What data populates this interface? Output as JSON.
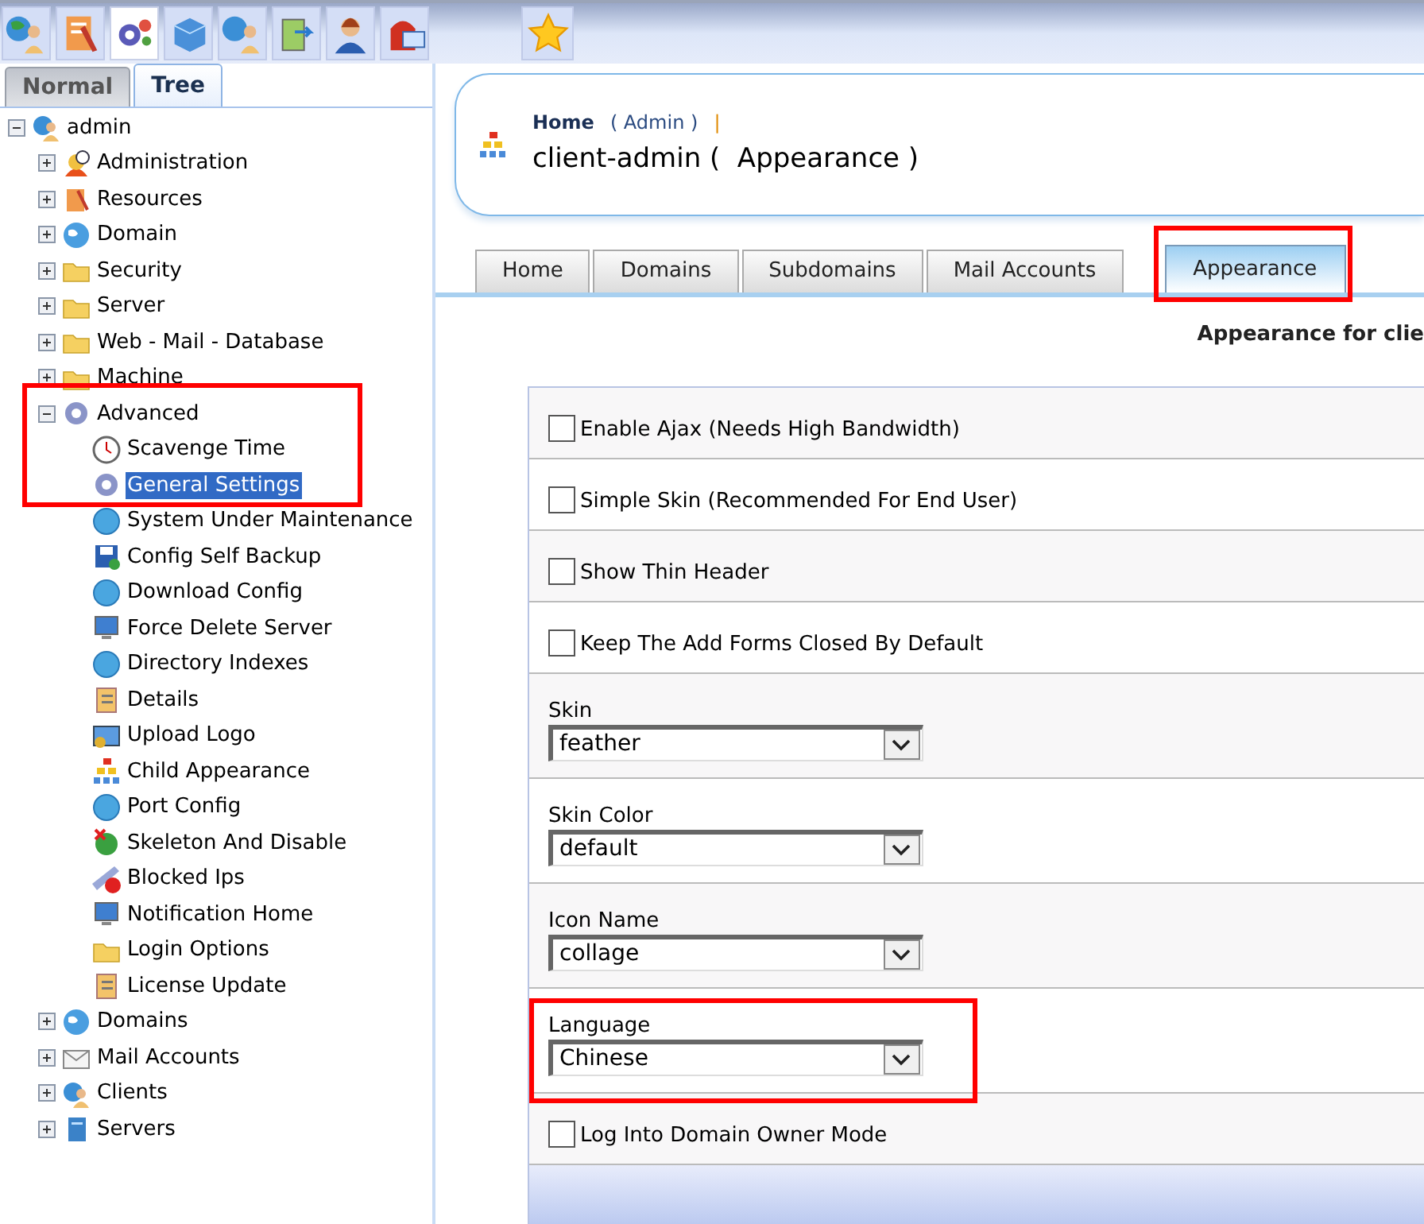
{
  "toolbar": {
    "buttons": [
      {
        "selected": false
      },
      {
        "selected": false
      },
      {
        "selected": true
      },
      {
        "selected": false
      },
      {
        "selected": false
      },
      {
        "selected": false
      },
      {
        "selected": false
      },
      {
        "selected": false
      }
    ]
  },
  "sidebar": {
    "tabs": [
      {
        "label": "Normal",
        "selected": false
      },
      {
        "label": "Tree",
        "selected": true
      }
    ],
    "tree": [
      {
        "label": "admin",
        "expanded": true,
        "selected": false,
        "children": [
          {
            "label": "Administration",
            "expanded": false,
            "selected": false
          },
          {
            "label": "Resources",
            "expanded": false,
            "selected": false
          },
          {
            "label": "Domain",
            "expanded": false,
            "selected": false
          },
          {
            "label": "Security",
            "expanded": false,
            "selected": false
          },
          {
            "label": "Server",
            "expanded": false,
            "selected": false
          },
          {
            "label": "Web - Mail - Database",
            "expanded": false,
            "selected": false
          },
          {
            "label": "Machine",
            "expanded": false,
            "selected": false
          },
          {
            "label": "Advanced",
            "expanded": true,
            "selected": false,
            "highlighted": true,
            "children": [
              {
                "label": "Scavenge Time",
                "selected": false
              },
              {
                "label": "General Settings",
                "selected": true
              },
              {
                "label": "System Under Maintenance",
                "selected": false
              },
              {
                "label": "Config Self Backup",
                "selected": false
              },
              {
                "label": "Download Config",
                "selected": false
              },
              {
                "label": "Force Delete Server",
                "selected": false
              },
              {
                "label": "Directory Indexes",
                "selected": false
              },
              {
                "label": "Details",
                "selected": false
              },
              {
                "label": "Upload Logo",
                "selected": false
              },
              {
                "label": "Child Appearance",
                "selected": false
              },
              {
                "label": "Port Config",
                "selected": false
              },
              {
                "label": "Skeleton And Disable",
                "selected": false
              },
              {
                "label": "Blocked Ips",
                "selected": false
              },
              {
                "label": "Notification Home",
                "selected": false
              },
              {
                "label": "Login Options",
                "selected": false
              },
              {
                "label": "License Update",
                "selected": false
              }
            ]
          },
          {
            "label": "Domains",
            "expanded": false,
            "selected": false
          },
          {
            "label": "Mail Accounts",
            "expanded": false,
            "selected": false
          },
          {
            "label": "Clients",
            "expanded": false,
            "selected": false
          },
          {
            "label": "Servers",
            "expanded": false,
            "selected": false
          }
        ]
      }
    ]
  },
  "header": {
    "breadcrumb": "Home",
    "user": "( Admin )",
    "separator": "|",
    "title": "client-admin (  Appearance )"
  },
  "tabs": [
    {
      "label": "Home",
      "selected": false,
      "highlighted": false
    },
    {
      "label": "Domains",
      "selected": false,
      "highlighted": false
    },
    {
      "label": "Subdomains",
      "selected": false,
      "highlighted": false
    },
    {
      "label": "Mail Accounts",
      "selected": false,
      "highlighted": false
    },
    {
      "label": "Appearance",
      "selected": true,
      "highlighted": true
    }
  ],
  "form": {
    "title": "Appearance for clie",
    "rows": [
      {
        "kind": "checkbox",
        "label": "Enable Ajax (Needs High Bandwidth)",
        "checked": false
      },
      {
        "kind": "checkbox",
        "label": "Simple Skin (Recommended For End User)",
        "checked": false
      },
      {
        "kind": "checkbox",
        "label": "Show Thin Header",
        "checked": false
      },
      {
        "kind": "checkbox",
        "label": "Keep The Add Forms Closed By Default",
        "checked": false
      },
      {
        "kind": "select",
        "label": "Skin",
        "value": "feather",
        "highlighted": false
      },
      {
        "kind": "select",
        "label": "Skin Color",
        "value": "default",
        "highlighted": false
      },
      {
        "kind": "select",
        "label": "Icon Name",
        "value": "collage",
        "highlighted": false
      },
      {
        "kind": "select",
        "label": "Language",
        "value": "Chinese",
        "highlighted": true
      },
      {
        "kind": "checkbox",
        "label": "Log Into Domain Owner Mode",
        "checked": false
      }
    ]
  }
}
